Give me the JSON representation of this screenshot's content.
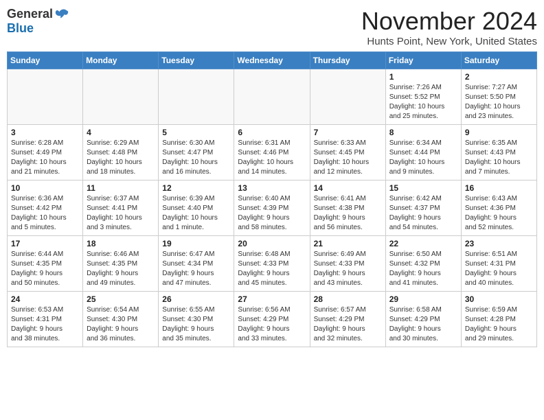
{
  "header": {
    "logo_general": "General",
    "logo_blue": "Blue",
    "month_title": "November 2024",
    "location": "Hunts Point, New York, United States"
  },
  "days_of_week": [
    "Sunday",
    "Monday",
    "Tuesday",
    "Wednesday",
    "Thursday",
    "Friday",
    "Saturday"
  ],
  "weeks": [
    [
      {
        "day": "",
        "info": ""
      },
      {
        "day": "",
        "info": ""
      },
      {
        "day": "",
        "info": ""
      },
      {
        "day": "",
        "info": ""
      },
      {
        "day": "",
        "info": ""
      },
      {
        "day": "1",
        "info": "Sunrise: 7:26 AM\nSunset: 5:52 PM\nDaylight: 10 hours\nand 25 minutes."
      },
      {
        "day": "2",
        "info": "Sunrise: 7:27 AM\nSunset: 5:50 PM\nDaylight: 10 hours\nand 23 minutes."
      }
    ],
    [
      {
        "day": "3",
        "info": "Sunrise: 6:28 AM\nSunset: 4:49 PM\nDaylight: 10 hours\nand 21 minutes."
      },
      {
        "day": "4",
        "info": "Sunrise: 6:29 AM\nSunset: 4:48 PM\nDaylight: 10 hours\nand 18 minutes."
      },
      {
        "day": "5",
        "info": "Sunrise: 6:30 AM\nSunset: 4:47 PM\nDaylight: 10 hours\nand 16 minutes."
      },
      {
        "day": "6",
        "info": "Sunrise: 6:31 AM\nSunset: 4:46 PM\nDaylight: 10 hours\nand 14 minutes."
      },
      {
        "day": "7",
        "info": "Sunrise: 6:33 AM\nSunset: 4:45 PM\nDaylight: 10 hours\nand 12 minutes."
      },
      {
        "day": "8",
        "info": "Sunrise: 6:34 AM\nSunset: 4:44 PM\nDaylight: 10 hours\nand 9 minutes."
      },
      {
        "day": "9",
        "info": "Sunrise: 6:35 AM\nSunset: 4:43 PM\nDaylight: 10 hours\nand 7 minutes."
      }
    ],
    [
      {
        "day": "10",
        "info": "Sunrise: 6:36 AM\nSunset: 4:42 PM\nDaylight: 10 hours\nand 5 minutes."
      },
      {
        "day": "11",
        "info": "Sunrise: 6:37 AM\nSunset: 4:41 PM\nDaylight: 10 hours\nand 3 minutes."
      },
      {
        "day": "12",
        "info": "Sunrise: 6:39 AM\nSunset: 4:40 PM\nDaylight: 10 hours\nand 1 minute."
      },
      {
        "day": "13",
        "info": "Sunrise: 6:40 AM\nSunset: 4:39 PM\nDaylight: 9 hours\nand 58 minutes."
      },
      {
        "day": "14",
        "info": "Sunrise: 6:41 AM\nSunset: 4:38 PM\nDaylight: 9 hours\nand 56 minutes."
      },
      {
        "day": "15",
        "info": "Sunrise: 6:42 AM\nSunset: 4:37 PM\nDaylight: 9 hours\nand 54 minutes."
      },
      {
        "day": "16",
        "info": "Sunrise: 6:43 AM\nSunset: 4:36 PM\nDaylight: 9 hours\nand 52 minutes."
      }
    ],
    [
      {
        "day": "17",
        "info": "Sunrise: 6:44 AM\nSunset: 4:35 PM\nDaylight: 9 hours\nand 50 minutes."
      },
      {
        "day": "18",
        "info": "Sunrise: 6:46 AM\nSunset: 4:35 PM\nDaylight: 9 hours\nand 49 minutes."
      },
      {
        "day": "19",
        "info": "Sunrise: 6:47 AM\nSunset: 4:34 PM\nDaylight: 9 hours\nand 47 minutes."
      },
      {
        "day": "20",
        "info": "Sunrise: 6:48 AM\nSunset: 4:33 PM\nDaylight: 9 hours\nand 45 minutes."
      },
      {
        "day": "21",
        "info": "Sunrise: 6:49 AM\nSunset: 4:33 PM\nDaylight: 9 hours\nand 43 minutes."
      },
      {
        "day": "22",
        "info": "Sunrise: 6:50 AM\nSunset: 4:32 PM\nDaylight: 9 hours\nand 41 minutes."
      },
      {
        "day": "23",
        "info": "Sunrise: 6:51 AM\nSunset: 4:31 PM\nDaylight: 9 hours\nand 40 minutes."
      }
    ],
    [
      {
        "day": "24",
        "info": "Sunrise: 6:53 AM\nSunset: 4:31 PM\nDaylight: 9 hours\nand 38 minutes."
      },
      {
        "day": "25",
        "info": "Sunrise: 6:54 AM\nSunset: 4:30 PM\nDaylight: 9 hours\nand 36 minutes."
      },
      {
        "day": "26",
        "info": "Sunrise: 6:55 AM\nSunset: 4:30 PM\nDaylight: 9 hours\nand 35 minutes."
      },
      {
        "day": "27",
        "info": "Sunrise: 6:56 AM\nSunset: 4:29 PM\nDaylight: 9 hours\nand 33 minutes."
      },
      {
        "day": "28",
        "info": "Sunrise: 6:57 AM\nSunset: 4:29 PM\nDaylight: 9 hours\nand 32 minutes."
      },
      {
        "day": "29",
        "info": "Sunrise: 6:58 AM\nSunset: 4:29 PM\nDaylight: 9 hours\nand 30 minutes."
      },
      {
        "day": "30",
        "info": "Sunrise: 6:59 AM\nSunset: 4:28 PM\nDaylight: 9 hours\nand 29 minutes."
      }
    ]
  ]
}
